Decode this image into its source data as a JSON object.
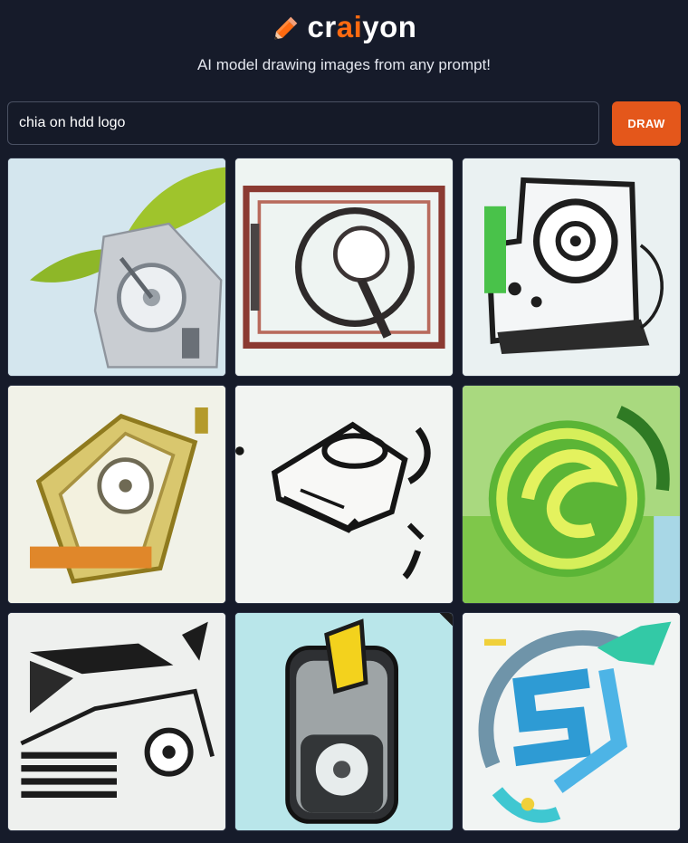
{
  "header": {
    "logo_text_pre": "cr",
    "logo_text_accent": "ai",
    "logo_text_post": "yon",
    "tagline": "AI model drawing images from any prompt!"
  },
  "search": {
    "value": "chia on hdd logo",
    "draw_label": "DRAW"
  },
  "results": {
    "images": [
      {
        "name": "result-image-1",
        "description": "hard drive with green leaf"
      },
      {
        "name": "result-image-2",
        "description": "outlined hard drive platter"
      },
      {
        "name": "result-image-3",
        "description": "sketched hard drive with green strip"
      },
      {
        "name": "result-image-4",
        "description": "tilted yellow-orange hard drive"
      },
      {
        "name": "result-image-5",
        "description": "black line-art hard drive"
      },
      {
        "name": "result-image-6",
        "description": "green circular logo"
      },
      {
        "name": "result-image-7",
        "description": "black and white angular drive sketch"
      },
      {
        "name": "result-image-8",
        "description": "dark drive with yellow slot"
      },
      {
        "name": "result-image-9",
        "description": "blue and teal S-shaped logo"
      }
    ]
  },
  "colors": {
    "background": "#161b2a",
    "accent": "#ff6a10",
    "button": "#e4571b"
  }
}
